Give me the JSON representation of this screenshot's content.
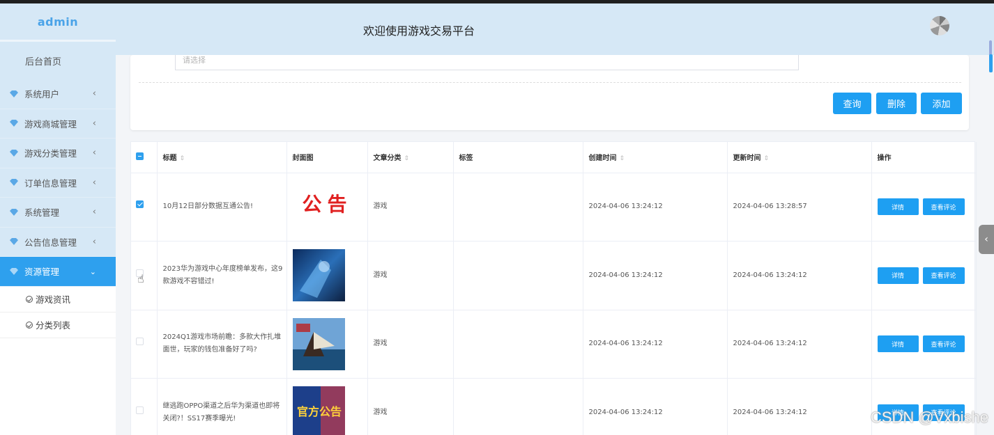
{
  "sidebar": {
    "brand": "admin",
    "home": "后台首页",
    "items": [
      {
        "label": "系统用户",
        "active": false
      },
      {
        "label": "游戏商城管理",
        "active": false
      },
      {
        "label": "游戏分类管理",
        "active": false
      },
      {
        "label": "订单信息管理",
        "active": false
      },
      {
        "label": "系统管理",
        "active": false
      },
      {
        "label": "公告信息管理",
        "active": false
      },
      {
        "label": "资源管理",
        "active": true
      }
    ],
    "subitems": [
      "游戏资讯",
      "分类列表"
    ]
  },
  "header": {
    "title": "欢迎使用游戏交易平台"
  },
  "search": {
    "placeholder": "请选择",
    "query_label": "查询",
    "delete_label": "删除",
    "add_label": "添加"
  },
  "table": {
    "columns": [
      "标题",
      "封面图",
      "文章分类",
      "标签",
      "创建时间",
      "更新时间",
      "操作"
    ],
    "detail_label": "详情",
    "review_label": "查看评论",
    "rows": [
      {
        "title": "10月12日部分数据互通公告!",
        "cover_text": "公告",
        "category": "游戏",
        "tag": "",
        "created": "2024-04-06 13:24:12",
        "updated": "2024-04-06 13:28:57",
        "checked": true
      },
      {
        "title": "2023华为游戏中心年度榜单发布，这9款游戏不容错过!",
        "cover_text": "",
        "category": "游戏",
        "tag": "",
        "created": "2024-04-06 13:24:12",
        "updated": "2024-04-06 13:24:12",
        "checked": false
      },
      {
        "title": "2024Q1游戏市场前瞻：多款大作扎堆面世，玩家的钱包准备好了吗?",
        "cover_text": "",
        "category": "游戏",
        "tag": "",
        "created": "2024-04-06 13:24:12",
        "updated": "2024-04-06 13:24:12",
        "checked": false
      },
      {
        "title": "继逃跑OPPO渠道之后华为渠道也即将关闭?！SS17赛季曝光!",
        "cover_text": "官方公告",
        "category": "游戏",
        "tag": "",
        "created": "2024-04-06 13:24:12",
        "updated": "2024-04-06 13:24:12",
        "checked": false
      }
    ]
  },
  "watermark": "CSDN @Vxbishe",
  "colors": {
    "accent": "#1e9ff2",
    "header_bg": "#d6e8f6",
    "brand_text": "#4aa3e8"
  }
}
